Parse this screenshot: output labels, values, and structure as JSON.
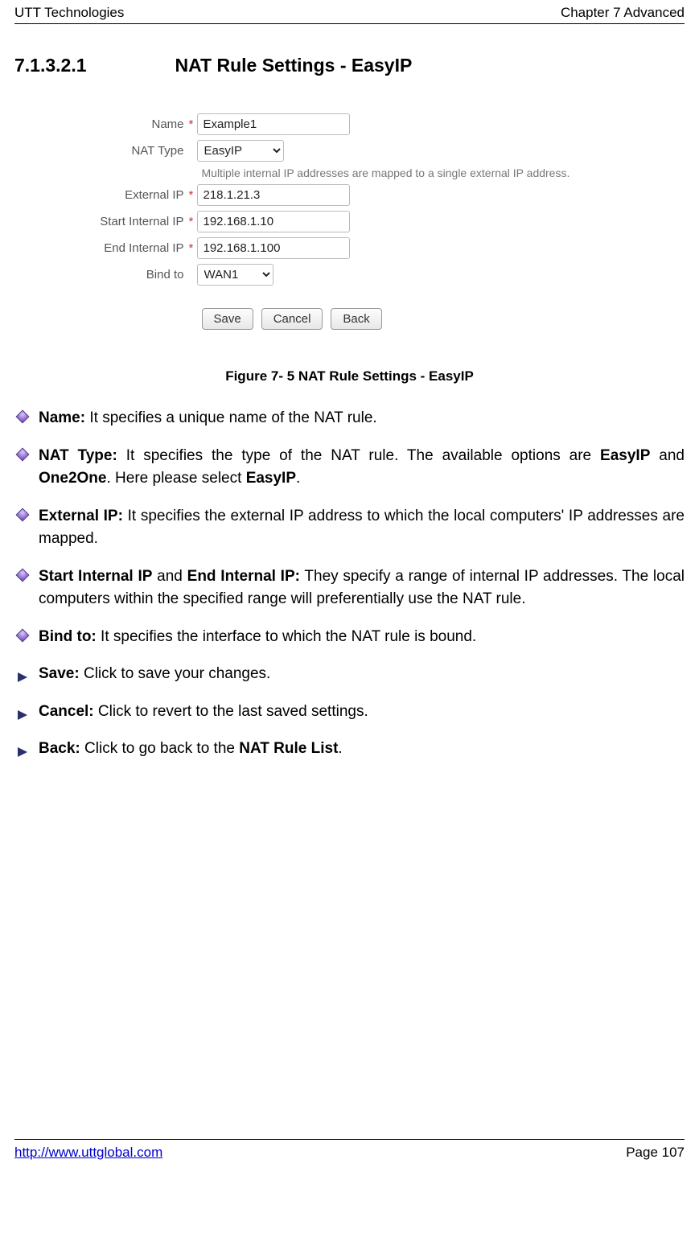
{
  "header": {
    "left": "UTT Technologies",
    "right": "Chapter 7 Advanced"
  },
  "section": {
    "number": "7.1.3.2.1",
    "title": "NAT Rule Settings - EasyIP"
  },
  "form": {
    "name_label": "Name",
    "name_value": "Example1",
    "nat_type_label": "NAT Type",
    "nat_type_value": "EasyIP",
    "helper_text": "Multiple internal IP addresses are mapped to a single external IP address.",
    "external_ip_label": "External IP",
    "external_ip_value": "218.1.21.3",
    "start_ip_label": "Start Internal IP",
    "start_ip_value": "192.168.1.10",
    "end_ip_label": "End Internal IP",
    "end_ip_value": "192.168.1.100",
    "bind_label": "Bind to",
    "bind_value": "WAN1",
    "asterisk": "*",
    "buttons": {
      "save": "Save",
      "cancel": "Cancel",
      "back": "Back"
    }
  },
  "figure_caption": "Figure 7- 5 NAT Rule Settings - EasyIP",
  "bullets": {
    "name_b": "Name:",
    "name_t": " It specifies a unique name of the NAT rule.",
    "nat_b1": "NAT Type:",
    "nat_t1": " It specifies the type of the NAT rule. The available options are ",
    "nat_b2": "EasyIP",
    "nat_mid": " and ",
    "nat_b3": "One2One",
    "nat_t2": ". Here please select ",
    "nat_b4": "EasyIP",
    "nat_end": ".",
    "ext_b": "External IP:",
    "ext_t": " It specifies the external IP address to which the local computers' IP addresses are mapped.",
    "sip_b1": "Start Internal IP",
    "sip_mid": " and ",
    "sip_b2": "End Internal IP:",
    "sip_t": " They specify a range of internal IP addresses. The local computers within the specified range will preferentially use the NAT rule.",
    "bind_b": "Bind to:",
    "bind_t": " It specifies the interface to which the NAT rule is bound.",
    "save_b": "Save:",
    "save_t": " Click to save your changes.",
    "cancel_b": "Cancel:",
    "cancel_t": " Click to revert to the last saved settings.",
    "back_b": "Back:",
    "back_t1": " Click to go back to the ",
    "back_b2": "NAT Rule List",
    "back_end": "."
  },
  "footer": {
    "url": "http://www.uttglobal.com",
    "page": "Page 107"
  }
}
